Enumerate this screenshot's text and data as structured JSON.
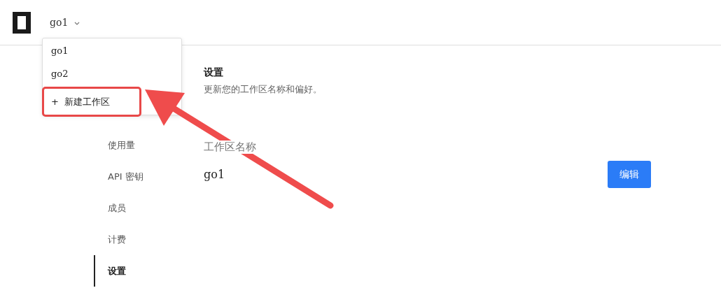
{
  "header": {
    "workspace": "go1"
  },
  "dropdown": {
    "items": [
      {
        "label": "go1",
        "kind": "workspace"
      },
      {
        "label": "go2",
        "kind": "workspace"
      },
      {
        "label": "+  新建工作区",
        "kind": "create"
      }
    ]
  },
  "sidebar": {
    "items": [
      {
        "label": "使用量",
        "selected": false
      },
      {
        "label": "API 密钥",
        "selected": false
      },
      {
        "label": "成员",
        "selected": false
      },
      {
        "label": "计费",
        "selected": false
      },
      {
        "label": "设置",
        "selected": true
      }
    ]
  },
  "main": {
    "title": "设置",
    "subtitle": "更新您的工作区名称和偏好。",
    "field_label": "工作区名称",
    "field_value": "go1",
    "edit_button": "编辑"
  }
}
